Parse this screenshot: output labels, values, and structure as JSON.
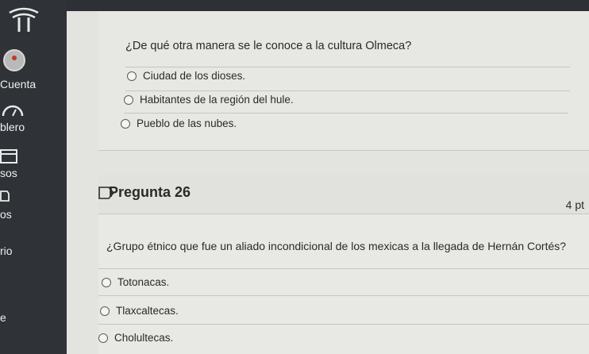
{
  "sidebar": {
    "items": [
      {
        "label": "Cuenta",
        "icon": "avatar-icon"
      },
      {
        "label": "blero",
        "icon": "gauge-icon"
      },
      {
        "label": "sos",
        "icon": "calendar-icon"
      },
      {
        "label": "os",
        "icon": "inbox-icon"
      },
      {
        "label": "rio",
        "icon": ""
      },
      {
        "label": "e",
        "icon": ""
      }
    ]
  },
  "previous_question": {
    "text": "¿De qué otra manera se le conoce a la cultura Olmeca?",
    "options": [
      "Ciudad de los dioses.",
      "Habitantes de la región del hule.",
      "Pueblo de las nubes."
    ]
  },
  "question": {
    "title": "Pregunta 26",
    "points": "4 pt",
    "text": "¿Grupo étnico que fue un aliado incondicional de los mexicas a la llegada de Hernán Cortés?",
    "options": [
      "Totonacas.",
      "Tlaxcaltecas.",
      "Cholultecas."
    ]
  },
  "colors": {
    "sidebar": "#2f3236",
    "content": "#e3e3df"
  }
}
